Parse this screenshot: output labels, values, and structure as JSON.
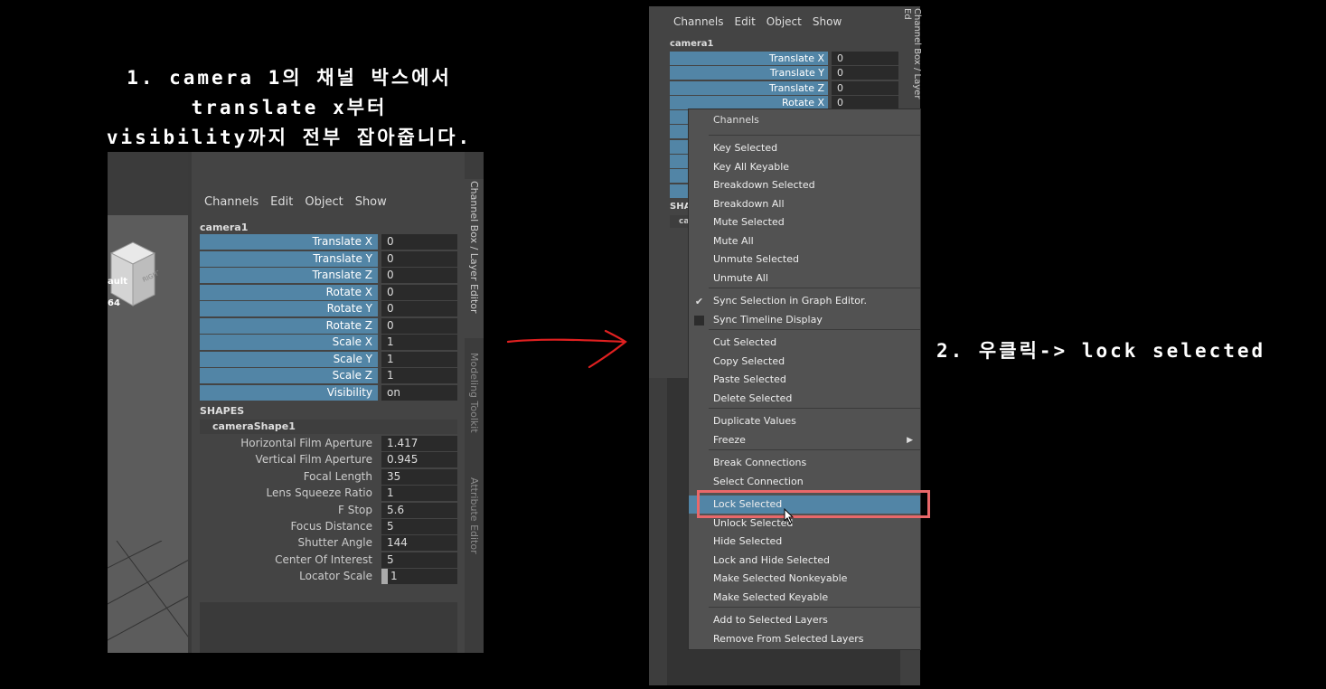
{
  "captions": {
    "step1_line1": "1. camera 1의 채널 박스에서",
    "step1_line2": "translate x부터",
    "step1_line3": "visibility까지 전부 잡아줍니다.",
    "step2": "2. 우클릭-> lock selected"
  },
  "left_panel": {
    "viewport": {
      "label1": "ault",
      "label2": "64"
    },
    "channel_box": {
      "menu": [
        "Channels",
        "Edit",
        "Object",
        "Show"
      ],
      "object_name": "camera1",
      "channels": [
        {
          "name": "Translate X",
          "value": "0"
        },
        {
          "name": "Translate Y",
          "value": "0"
        },
        {
          "name": "Translate Z",
          "value": "0"
        },
        {
          "name": "Rotate X",
          "value": "0"
        },
        {
          "name": "Rotate Y",
          "value": "0"
        },
        {
          "name": "Rotate Z",
          "value": "0"
        },
        {
          "name": "Scale X",
          "value": "1"
        },
        {
          "name": "Scale Y",
          "value": "1"
        },
        {
          "name": "Scale Z",
          "value": "1"
        },
        {
          "name": "Visibility",
          "value": "on"
        }
      ],
      "shapes_header": "SHAPES",
      "shape_name": "cameraShape1",
      "shape_attrs": [
        {
          "name": "Horizontal Film Aperture",
          "value": "1.417"
        },
        {
          "name": "Vertical Film Aperture",
          "value": "0.945"
        },
        {
          "name": "Focal Length",
          "value": "35"
        },
        {
          "name": "Lens Squeeze Ratio",
          "value": "1"
        },
        {
          "name": "F Stop",
          "value": "5.6"
        },
        {
          "name": "Focus Distance",
          "value": "5"
        },
        {
          "name": "Shutter Angle",
          "value": "144"
        },
        {
          "name": "Center Of Interest",
          "value": "5"
        },
        {
          "name": "Locator Scale",
          "value": "1"
        }
      ]
    },
    "side_tabs": [
      "Channel Box / Layer Editor",
      "Modeling Toolkit",
      "Attribute Editor"
    ],
    "icons": [
      "transform-axes-icon",
      "camera-icon",
      "pencil-icon"
    ]
  },
  "right_panel": {
    "menu": [
      "Channels",
      "Edit",
      "Object",
      "Show"
    ],
    "object_name": "camera1",
    "channels": [
      {
        "name": "Translate X",
        "value": "0"
      },
      {
        "name": "Translate Y",
        "value": "0"
      },
      {
        "name": "Translate Z",
        "value": "0"
      },
      {
        "name": "Rotate X",
        "value": "0"
      }
    ],
    "shapes_stub": "SHA",
    "shape_stub": "ca",
    "side_tab": "Channel Box / Layer Ed",
    "context_menu": {
      "header": "Channels",
      "items": [
        {
          "label": "Key Selected"
        },
        {
          "label": "Key All Keyable"
        },
        {
          "label": "Breakdown Selected"
        },
        {
          "label": "Breakdown All"
        },
        {
          "label": "Mute Selected"
        },
        {
          "label": "Mute All"
        },
        {
          "label": "Unmute Selected"
        },
        {
          "label": "Unmute All"
        },
        {
          "label": "Sync Selection in Graph Editor."
        },
        {
          "label": "Sync Timeline Display"
        },
        {
          "label": "Cut Selected"
        },
        {
          "label": "Copy Selected"
        },
        {
          "label": "Paste Selected"
        },
        {
          "label": "Delete Selected"
        },
        {
          "label": "Duplicate Values"
        },
        {
          "label": "Freeze"
        },
        {
          "label": "Break Connections"
        },
        {
          "label": "Select Connection"
        },
        {
          "label": "Lock Selected"
        },
        {
          "label": "Unlock Selected"
        },
        {
          "label": "Hide Selected"
        },
        {
          "label": "Lock and Hide Selected"
        },
        {
          "label": "Make Selected Nonkeyable"
        },
        {
          "label": "Make Selected Keyable"
        },
        {
          "label": "Add to Selected Layers"
        },
        {
          "label": "Remove From Selected Layers"
        }
      ],
      "checked_item": "Sync Selection in Graph Editor.",
      "highlighted_item": "Lock Selected"
    }
  },
  "colors": {
    "channel_blue": "#5285a6",
    "highlight_box": "#e8686a",
    "arrow": "#e02020"
  }
}
